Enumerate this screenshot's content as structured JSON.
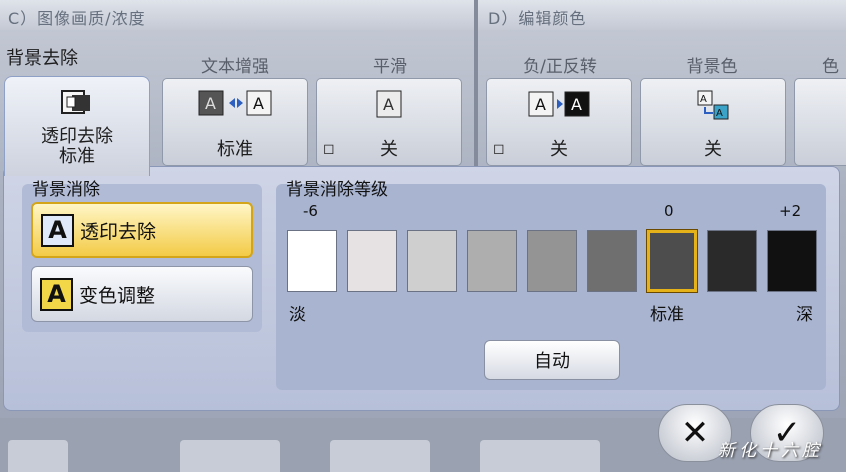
{
  "header": {
    "section_c": "C）图像画质/浓度",
    "section_d": "D）编辑颜色"
  },
  "bg_removal_label": "背景去除",
  "columns": [
    {
      "label": "文本增强",
      "value": "标准"
    },
    {
      "label": "平滑",
      "value": "关"
    },
    {
      "label": "负/正反转",
      "value": "关"
    },
    {
      "label": "背景色",
      "value": "关"
    },
    {
      "label": "色"
    }
  ],
  "active_tile": {
    "line1": "透印去除",
    "line2": "标准"
  },
  "panel": {
    "left_title": "背景消除",
    "options": [
      {
        "glyph": "A",
        "label": "透印去除",
        "selected": true
      },
      {
        "glyph": "A",
        "label": "变色调整",
        "selected": false
      }
    ],
    "right_title": "背景消除等级",
    "ticks": [
      "-6",
      "0",
      "+2"
    ],
    "levels": [
      "#ffffff",
      "#e6e2e3",
      "#cfcfcf",
      "#aeaeae",
      "#949494",
      "#6f6f6f",
      "#4d4d4d",
      "#2a2a2a",
      "#111111"
    ],
    "selected_level_index": 6,
    "level_labels": {
      "light": "淡",
      "standard": "标准",
      "dark": "深"
    },
    "auto_label": "自动"
  },
  "footer": {
    "cancel_glyph": "✕",
    "ok_glyph": "✓",
    "watermark": "新化十六腔"
  }
}
